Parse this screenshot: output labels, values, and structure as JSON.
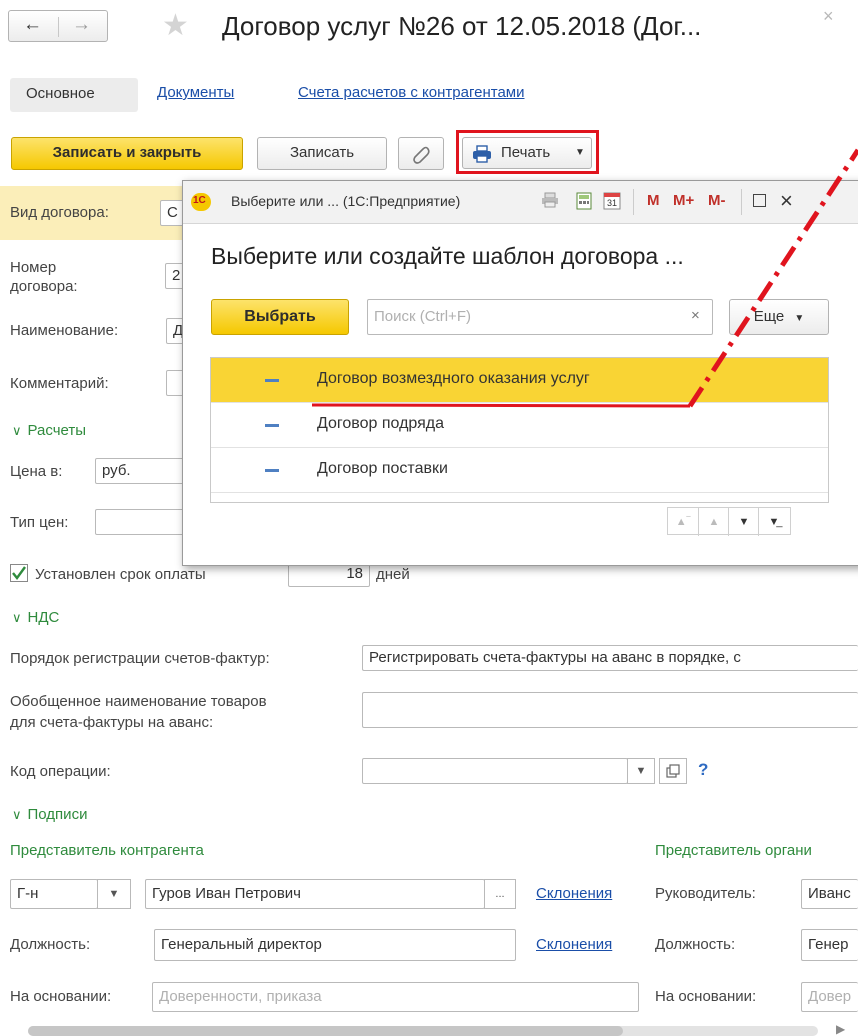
{
  "header": {
    "title": "Договор услуг №26 от 12.05.2018 (Дог...",
    "back_icon": "←",
    "forward_icon": "→",
    "star_icon": "★",
    "close_icon": "×"
  },
  "tabs": [
    {
      "label": "Основное"
    },
    {
      "label": "Документы"
    },
    {
      "label": "Счета расчетов с контрагентами"
    }
  ],
  "toolbar": {
    "save_close": "Записать и закрыть",
    "save": "Записать",
    "print": "Печать"
  },
  "form": {
    "contract_type_label": "Вид договора:",
    "contract_type_value": "С",
    "number_label": "Номер договора:",
    "number_value": "2",
    "name_label": "Наименование:",
    "name_value": "Д",
    "comment_label": "Комментарий:",
    "section_calc": "Расчеты",
    "price_in_label": "Цена в:",
    "price_in_value": "руб.",
    "price_type_label": "Тип цен:",
    "payment_term_label": "Установлен срок оплаты",
    "payment_term_value": "18",
    "payment_term_unit": "дней",
    "section_vat": "НДС",
    "invoice_order_label": "Порядок регистрации счетов-фактур:",
    "invoice_order_value": "Регистрировать счета-фактуры на аванс в порядке, с",
    "generic_name_label_1": "Обобщенное наименование товаров",
    "generic_name_label_2": "для счета-фактуры на аванс:",
    "op_code_label": "Код операции:",
    "op_code_help": "?",
    "section_signatures": "Подписи",
    "contractor_rep": "Представитель контрагента",
    "org_rep": "Представитель органи",
    "title_value": "Г-н",
    "rep_name": "Гуров Иван Петрович",
    "declensions_1": "Склонения",
    "head_label": "Руководитель:",
    "head_value": "Иванс",
    "position_label": "Должность:",
    "position_value": "Генеральный директор",
    "declensions_2": "Склонения",
    "position_label_2": "Должность:",
    "position_value_2": "Генер",
    "basis_label": "На основании:",
    "basis_placeholder": "Доверенности, приказа",
    "basis_label_2": "На основании:",
    "basis_placeholder_2": "Довер"
  },
  "dialog": {
    "window_title": "Выберите или ... (1С:Предприятие)",
    "app_badge": "1С",
    "heading": "Выберите или создайте шаблон договора ...",
    "select_button": "Выбрать",
    "search_placeholder": "Поиск (Ctrl+F)",
    "search_clear": "×",
    "more_button": "Еще",
    "tb_m": "M",
    "tb_mplus": "M+",
    "tb_mminus": "M-",
    "tb_calendar": "31",
    "items": [
      {
        "label": "Договор возмездного оказания услуг",
        "selected": true
      },
      {
        "label": "Договор подряда",
        "selected": false
      },
      {
        "label": "Договор поставки",
        "selected": false
      }
    ]
  },
  "colors": {
    "accent_yellow": "#f5c800",
    "selection_row": "#f9d434",
    "annotation_red": "#e0141e",
    "section_green": "#2f8b3d",
    "link_blue": "#1a4ea8"
  }
}
